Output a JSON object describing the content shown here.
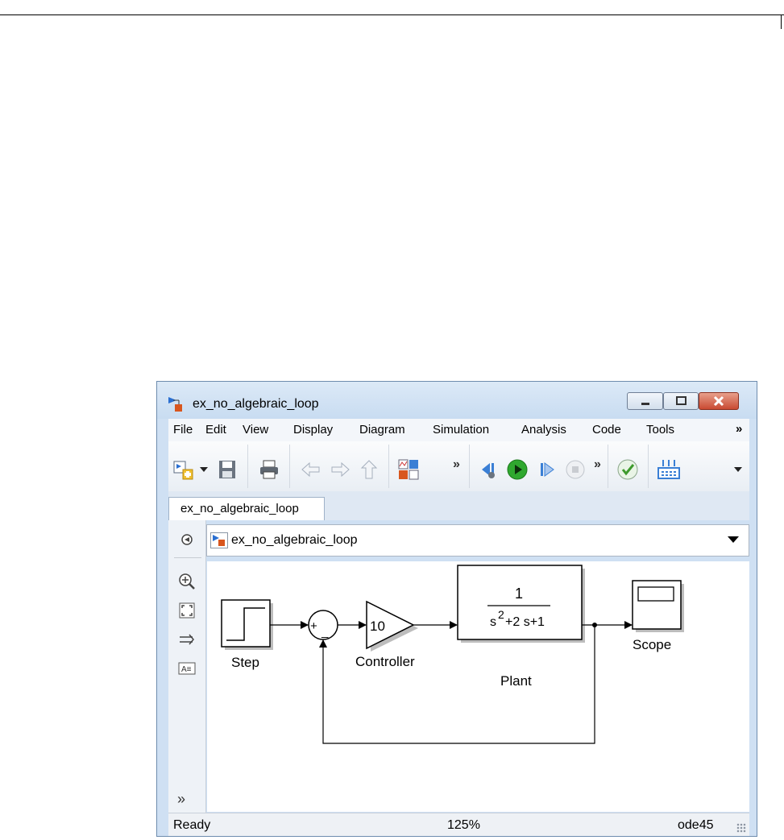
{
  "window": {
    "title": "ex_no_algebraic_loop"
  },
  "menubar": {
    "items": [
      "File",
      "Edit",
      "View",
      "Display",
      "Diagram",
      "Simulation",
      "Analysis",
      "Code",
      "Tools"
    ],
    "more": "»"
  },
  "toolbar": {
    "icons": [
      "new-model-icon",
      "dropdown-arrow-icon",
      "save-icon",
      "print-icon",
      "back-arrow-icon",
      "forward-arrow-icon",
      "up-arrow-icon",
      "library-browser-icon",
      "step-back-icon",
      "run-icon",
      "step-forward-icon",
      "stop-icon",
      "model-advisor-icon",
      "build-icon"
    ],
    "more_1": "»",
    "more_2": "»"
  },
  "tabs": [
    {
      "label": "ex_no_algebraic_loop"
    }
  ],
  "address": {
    "path": "ex_no_algebraic_loop"
  },
  "diagram": {
    "blocks": {
      "step": "Step",
      "controller": "Controller",
      "controller_gain": "10",
      "plant": "Plant",
      "plant_numerator": "1",
      "plant_denominator_s": "s",
      "plant_denominator_exp": "2",
      "plant_denominator_rest": "+2 s+1",
      "scope": "Scope",
      "sum_plus": "+",
      "sum_minus": "_"
    }
  },
  "status": {
    "state": "Ready",
    "zoom": "125%",
    "solver": "ode45"
  },
  "colors": {
    "titlebar": "#c8dcf1",
    "run_button": "#2fa82f",
    "advisor_check": "#3e9a2d",
    "close_button": "#c94a32"
  }
}
